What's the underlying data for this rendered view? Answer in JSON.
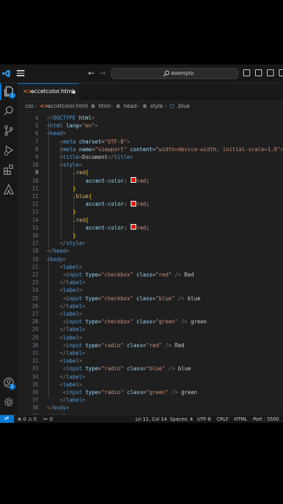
{
  "titlebar": {
    "search_text": "exemplo"
  },
  "tab": {
    "filename": "accetcolor.html",
    "icon_text": "<>"
  },
  "breadcrumb": [
    "css",
    "accetcolor.html",
    "html",
    "head",
    "style",
    ".blue"
  ],
  "activitybar": {
    "explorer_badge": "1",
    "accounts_badge": "1"
  },
  "editor": {
    "active_line": 11,
    "lines": [
      {
        "n": "4",
        "t": [
          [
            "t-br",
            "<"
          ],
          [
            "t-doc",
            "!DOCTYPE"
          ],
          [
            "t-pl",
            " "
          ],
          [
            "t-at",
            "html"
          ],
          [
            "t-br",
            ">"
          ]
        ],
        "i": 0
      },
      {
        "n": "5",
        "t": [
          [
            "t-br",
            "<"
          ],
          [
            "t-tag",
            "html"
          ],
          [
            "t-pl",
            " "
          ],
          [
            "t-at",
            "lang"
          ],
          [
            "t-pl",
            "="
          ],
          [
            "t-st",
            "\"en\""
          ],
          [
            "t-br",
            ">"
          ]
        ],
        "i": 0
      },
      {
        "n": "6",
        "t": [
          [
            "t-br",
            "<"
          ],
          [
            "t-tag",
            "head"
          ],
          [
            "t-br",
            ">"
          ]
        ],
        "i": 0
      },
      {
        "n": "7",
        "t": [
          [
            "t-br",
            "<"
          ],
          [
            "t-tag",
            "meta"
          ],
          [
            "t-pl",
            " "
          ],
          [
            "t-at",
            "charset"
          ],
          [
            "t-pl",
            "="
          ],
          [
            "t-st",
            "\"UTF-8\""
          ],
          [
            "t-br",
            ">"
          ]
        ],
        "i": 1
      },
      {
        "n": "8",
        "t": [
          [
            "t-br",
            "<"
          ],
          [
            "t-tag",
            "meta"
          ],
          [
            "t-pl",
            " "
          ],
          [
            "t-at",
            "name"
          ],
          [
            "t-pl",
            "="
          ],
          [
            "t-st",
            "\"viewport\""
          ],
          [
            "t-pl",
            " "
          ],
          [
            "t-at",
            "content"
          ],
          [
            "t-pl",
            "="
          ],
          [
            "t-st",
            "\"width=device-width, initial-scale=1.0\""
          ],
          [
            "t-br",
            ">"
          ]
        ],
        "i": 1
      },
      {
        "n": "9",
        "t": [
          [
            "t-br",
            "<"
          ],
          [
            "t-tag",
            "title"
          ],
          [
            "t-br",
            ">"
          ],
          [
            "t-pl",
            "Document"
          ],
          [
            "t-br",
            "</"
          ],
          [
            "t-tag",
            "title"
          ],
          [
            "t-br",
            ">"
          ]
        ],
        "i": 1
      },
      {
        "n": "10",
        "t": [
          [
            "t-br",
            "<"
          ],
          [
            "t-tag",
            "style"
          ],
          [
            "t-br",
            ">"
          ]
        ],
        "i": 1
      },
      {
        "n": "9",
        "t": [
          [
            "t-sel",
            ".red"
          ],
          [
            "t-brace",
            "{"
          ]
        ],
        "i": 2
      },
      {
        "n": "10",
        "t": [
          [
            "t-prop",
            "accent-color"
          ],
          [
            "t-pl",
            ": "
          ],
          [
            "sw",
            "#e51400"
          ],
          [
            "t-val",
            "red"
          ],
          [
            "t-pl",
            ";"
          ]
        ],
        "i": 3
      },
      {
        "n": "11",
        "t": [
          [
            "t-brace",
            "}"
          ]
        ],
        "i": 2
      },
      {
        "n": "11",
        "t": [
          [
            "t-sel",
            ".blue"
          ],
          [
            "t-brace",
            "{"
          ]
        ],
        "i": 2
      },
      {
        "n": "12",
        "t": [
          [
            "t-prop",
            "accent-color"
          ],
          [
            "t-pl",
            ": "
          ],
          [
            "sw",
            "#e51400"
          ],
          [
            "t-val",
            "red"
          ],
          [
            "t-pl",
            ";"
          ]
        ],
        "i": 3
      },
      {
        "n": "13",
        "t": [
          [
            "t-brace",
            "}"
          ]
        ],
        "i": 2
      },
      {
        "n": "14",
        "t": [
          [
            "t-sel",
            ".red"
          ],
          [
            "t-brace",
            "{"
          ]
        ],
        "i": 2
      },
      {
        "n": "15",
        "t": [
          [
            "t-prop",
            "accent-color"
          ],
          [
            "t-pl",
            ": "
          ],
          [
            "sw",
            "#e51400"
          ],
          [
            "t-val",
            "red"
          ],
          [
            "t-pl",
            ";"
          ]
        ],
        "i": 3
      },
      {
        "n": "16",
        "t": [
          [
            "t-brace",
            "}"
          ]
        ],
        "i": 2
      },
      {
        "n": "17",
        "t": [
          [
            "t-br",
            "</"
          ],
          [
            "t-tag",
            "style"
          ],
          [
            "t-br",
            ">"
          ]
        ],
        "i": 1
      },
      {
        "n": "18",
        "t": [
          [
            "t-br",
            "</"
          ],
          [
            "t-tag",
            "head"
          ],
          [
            "t-br",
            ">"
          ]
        ],
        "i": 0
      },
      {
        "n": "19",
        "t": [
          [
            "t-br",
            "<"
          ],
          [
            "t-tag",
            "body"
          ],
          [
            "t-br",
            ">"
          ]
        ],
        "i": 0
      },
      {
        "n": "21",
        "t": [
          [
            "t-br",
            "<"
          ],
          [
            "t-tag",
            "label"
          ],
          [
            "t-br",
            ">"
          ]
        ],
        "i": 1
      },
      {
        "n": "22",
        "t": [
          [
            "t-pl",
            " "
          ],
          [
            "t-br",
            "<"
          ],
          [
            "t-tag",
            "input"
          ],
          [
            "t-pl",
            " "
          ],
          [
            "t-at",
            "type"
          ],
          [
            "t-pl",
            "="
          ],
          [
            "t-st",
            "\"checkbox\""
          ],
          [
            "t-pl",
            " "
          ],
          [
            "t-at",
            "class"
          ],
          [
            "t-pl",
            "="
          ],
          [
            "t-st",
            "\"red\""
          ],
          [
            "t-pl",
            " "
          ],
          [
            "t-br",
            "/>"
          ],
          [
            "t-pl",
            " Red"
          ]
        ],
        "i": 1
      },
      {
        "n": "23",
        "t": [
          [
            "t-br",
            "</"
          ],
          [
            "t-tag",
            "label"
          ],
          [
            "t-br",
            ">"
          ]
        ],
        "i": 1
      },
      {
        "n": "24",
        "t": [
          [
            "t-br",
            "<"
          ],
          [
            "t-tag",
            "label"
          ],
          [
            "t-br",
            ">"
          ]
        ],
        "i": 1
      },
      {
        "n": "25",
        "t": [
          [
            "t-pl",
            " "
          ],
          [
            "t-br",
            "<"
          ],
          [
            "t-tag",
            "input"
          ],
          [
            "t-pl",
            " "
          ],
          [
            "t-at",
            "type"
          ],
          [
            "t-pl",
            "="
          ],
          [
            "t-st",
            "\"checkbox\""
          ],
          [
            "t-pl",
            " "
          ],
          [
            "t-at",
            "class"
          ],
          [
            "t-pl",
            "="
          ],
          [
            "t-st",
            "\"blue\""
          ],
          [
            "t-pl",
            " "
          ],
          [
            "t-br",
            "/>"
          ],
          [
            "t-pl",
            " blue"
          ]
        ],
        "i": 1
      },
      {
        "n": "26",
        "t": [
          [
            "t-br",
            "</"
          ],
          [
            "t-tag",
            "label"
          ],
          [
            "t-br",
            ">"
          ]
        ],
        "i": 1
      },
      {
        "n": "27",
        "t": [
          [
            "t-br",
            "<"
          ],
          [
            "t-tag",
            "label"
          ],
          [
            "t-br",
            ">"
          ]
        ],
        "i": 1
      },
      {
        "n": "28",
        "t": [
          [
            "t-pl",
            " "
          ],
          [
            "t-br",
            "<"
          ],
          [
            "t-tag",
            "input"
          ],
          [
            "t-pl",
            " "
          ],
          [
            "t-at",
            "type"
          ],
          [
            "t-pl",
            "="
          ],
          [
            "t-st",
            "\"checkbox\""
          ],
          [
            "t-pl",
            " "
          ],
          [
            "t-at",
            "class"
          ],
          [
            "t-pl",
            "="
          ],
          [
            "t-st",
            "\"green\""
          ],
          [
            "t-pl",
            " "
          ],
          [
            "t-br",
            "/>"
          ],
          [
            "t-pl",
            " green"
          ]
        ],
        "i": 1
      },
      {
        "n": "29",
        "t": [
          [
            "t-br",
            "</"
          ],
          [
            "t-tag",
            "label"
          ],
          [
            "t-br",
            ">"
          ]
        ],
        "i": 1
      },
      {
        "n": "29",
        "t": [
          [
            "t-br",
            "<"
          ],
          [
            "t-tag",
            "label"
          ],
          [
            "t-br",
            ">"
          ]
        ],
        "i": 1
      },
      {
        "n": "30",
        "t": [
          [
            "t-pl",
            " "
          ],
          [
            "t-br",
            "<"
          ],
          [
            "t-tag",
            "input"
          ],
          [
            "t-pl",
            " "
          ],
          [
            "t-at",
            "type"
          ],
          [
            "t-pl",
            "="
          ],
          [
            "t-st",
            "\"radio\""
          ],
          [
            "t-pl",
            " "
          ],
          [
            "t-at",
            "class"
          ],
          [
            "t-pl",
            "="
          ],
          [
            "t-st",
            "\"red\""
          ],
          [
            "t-pl",
            " "
          ],
          [
            "t-br",
            "/>"
          ],
          [
            "t-pl",
            " Red"
          ]
        ],
        "i": 1
      },
      {
        "n": "31",
        "t": [
          [
            "t-br",
            "</"
          ],
          [
            "t-tag",
            "label"
          ],
          [
            "t-br",
            ">"
          ]
        ],
        "i": 1
      },
      {
        "n": "32",
        "t": [
          [
            "t-br",
            "<"
          ],
          [
            "t-tag",
            "label"
          ],
          [
            "t-br",
            ">"
          ]
        ],
        "i": 1
      },
      {
        "n": "33",
        "t": [
          [
            "t-pl",
            " "
          ],
          [
            "t-br",
            "<"
          ],
          [
            "t-tag",
            "input"
          ],
          [
            "t-pl",
            " "
          ],
          [
            "t-at",
            "type"
          ],
          [
            "t-pl",
            "="
          ],
          [
            "t-st",
            "\"radio\""
          ],
          [
            "t-pl",
            " "
          ],
          [
            "t-at",
            "class"
          ],
          [
            "t-pl",
            "="
          ],
          [
            "t-st",
            "\"blue\""
          ],
          [
            "t-pl",
            " "
          ],
          [
            "t-br",
            "/>"
          ],
          [
            "t-pl",
            " blue"
          ]
        ],
        "i": 1
      },
      {
        "n": "34",
        "t": [
          [
            "t-br",
            "</"
          ],
          [
            "t-tag",
            "label"
          ],
          [
            "t-br",
            ">"
          ]
        ],
        "i": 1
      },
      {
        "n": "35",
        "t": [
          [
            "t-br",
            "<"
          ],
          [
            "t-tag",
            "label"
          ],
          [
            "t-br",
            ">"
          ]
        ],
        "i": 1
      },
      {
        "n": "36",
        "t": [
          [
            "t-pl",
            " "
          ],
          [
            "t-br",
            "<"
          ],
          [
            "t-tag",
            "input"
          ],
          [
            "t-pl",
            " "
          ],
          [
            "t-at",
            "type"
          ],
          [
            "t-pl",
            "="
          ],
          [
            "t-st",
            "\"radio\""
          ],
          [
            "t-pl",
            " "
          ],
          [
            "t-at",
            "class"
          ],
          [
            "t-pl",
            "="
          ],
          [
            "t-st",
            "\"green\""
          ],
          [
            "t-pl",
            " "
          ],
          [
            "t-br",
            "/>"
          ],
          [
            "t-pl",
            " green"
          ]
        ],
        "i": 1
      },
      {
        "n": "37",
        "t": [
          [
            "t-br",
            "</"
          ],
          [
            "t-tag",
            "label"
          ],
          [
            "t-br",
            ">"
          ]
        ],
        "i": 1
      },
      {
        "n": "38",
        "t": [
          [
            "t-br",
            "</"
          ],
          [
            "t-tag",
            "body"
          ],
          [
            "t-br",
            ">"
          ]
        ],
        "i": 0
      },
      {
        "n": "39",
        "t": [
          [
            "t-br",
            "</"
          ],
          [
            "t-tag",
            "html"
          ],
          [
            "t-br",
            ">"
          ]
        ],
        "i": 0
      }
    ]
  },
  "statusbar": {
    "errors": "0",
    "warnings": "0",
    "ports": "0",
    "position": "Ln 11, Col 14",
    "spaces": "Spaces: 4",
    "encoding": "UTF-8",
    "eol": "CRLF",
    "language": "HTML",
    "port": "Port : 5500"
  },
  "colors": {
    "accent": "#0078d4",
    "swatch_red": "#e51400",
    "editor_bg": "#1f1f1f"
  }
}
